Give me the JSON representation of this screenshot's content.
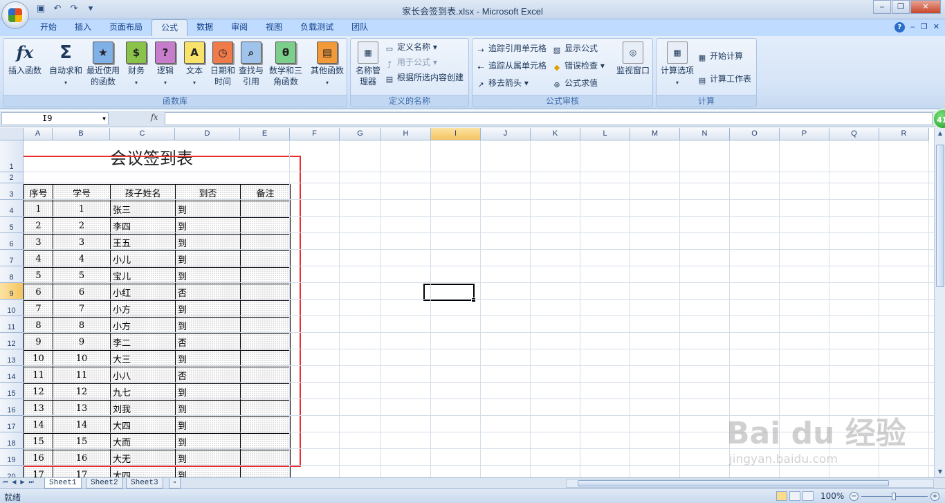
{
  "window": {
    "title": "家长会签到表.xlsx - Microsoft Excel",
    "controls": [
      "minimize",
      "restore",
      "close"
    ]
  },
  "ribbon": {
    "tabs": [
      "开始",
      "插入",
      "页面布局",
      "公式",
      "数据",
      "审阅",
      "视图",
      "负载测试",
      "团队"
    ],
    "active_tab": "公式",
    "groups": {
      "function_library": {
        "label": "函数库",
        "buttons": {
          "insert_function": "插入函数",
          "autosum": "自动求和",
          "recent": "最近使用的函数",
          "financial": "财务",
          "logical": "逻辑",
          "text": "文本",
          "datetime": "日期和时间",
          "lookup": "查找与引用",
          "math": "数学和三角函数",
          "more": "其他函数"
        }
      },
      "defined_names": {
        "label": "定义的名称",
        "name_manager": "名称管理器",
        "define_name": "定义名称",
        "use_in_formula": "用于公式",
        "create_from_selection": "根据所选内容创建"
      },
      "formula_auditing": {
        "label": "公式审核",
        "trace_precedents": "追踪引用单元格",
        "trace_dependents": "追踪从属单元格",
        "remove_arrows": "移去箭头",
        "show_formulas": "显示公式",
        "error_checking": "错误检查",
        "evaluate_formula": "公式求值",
        "watch_window": "监视窗口"
      },
      "calculation": {
        "label": "计算",
        "options": "计算选项",
        "calc_now": "开始计算",
        "calc_sheet": "计算工作表"
      }
    }
  },
  "formula_bar": {
    "name_box": "I9",
    "fx": "fx",
    "formula": ""
  },
  "badge": "41",
  "grid": {
    "columns": [
      "A",
      "B",
      "C",
      "D",
      "E",
      "F",
      "G",
      "H",
      "I",
      "J",
      "K",
      "L",
      "M",
      "N",
      "O",
      "P",
      "Q",
      "R"
    ],
    "selected_column": "I",
    "rows": [
      "1",
      "2",
      "3",
      "4",
      "5",
      "6",
      "7",
      "8",
      "9",
      "10",
      "11",
      "12",
      "13",
      "14",
      "15",
      "16",
      "17",
      "18",
      "19",
      "20"
    ],
    "selected_row": "9"
  },
  "sheet": {
    "title": "会议签到表",
    "headers": [
      "序号",
      "学号",
      "孩子姓名",
      "到否",
      "备注"
    ],
    "records": [
      [
        "1",
        "1",
        "张三",
        "到",
        ""
      ],
      [
        "2",
        "2",
        "李四",
        "到",
        ""
      ],
      [
        "3",
        "3",
        "王五",
        "到",
        ""
      ],
      [
        "4",
        "4",
        "小儿",
        "到",
        ""
      ],
      [
        "5",
        "5",
        "宝儿",
        "到",
        ""
      ],
      [
        "6",
        "6",
        "小红",
        "否",
        ""
      ],
      [
        "7",
        "7",
        "小方",
        "到",
        ""
      ],
      [
        "8",
        "8",
        "小方",
        "到",
        ""
      ],
      [
        "9",
        "9",
        "李二",
        "否",
        ""
      ],
      [
        "10",
        "10",
        "大三",
        "到",
        ""
      ],
      [
        "11",
        "11",
        "小八",
        "否",
        ""
      ],
      [
        "12",
        "12",
        "九七",
        "到",
        ""
      ],
      [
        "13",
        "13",
        "刘我",
        "到",
        ""
      ],
      [
        "14",
        "14",
        "大四",
        "到",
        ""
      ],
      [
        "15",
        "15",
        "大而",
        "到",
        ""
      ],
      [
        "16",
        "16",
        "大无",
        "到",
        ""
      ],
      [
        "17",
        "17",
        "大四",
        "到",
        ""
      ]
    ]
  },
  "sheet_tabs": [
    "Sheet1",
    "Sheet2",
    "Sheet3"
  ],
  "active_sheet": "Sheet1",
  "status": {
    "ready": "就绪",
    "zoom": "100%"
  },
  "watermark": {
    "brand": "Bai du 经验",
    "url": "jingyan.baidu.com"
  },
  "colors": {
    "highlight_rect": "#e62e2e",
    "selected_header": "#f5c45f",
    "ribbon": "#d5e4f7"
  }
}
